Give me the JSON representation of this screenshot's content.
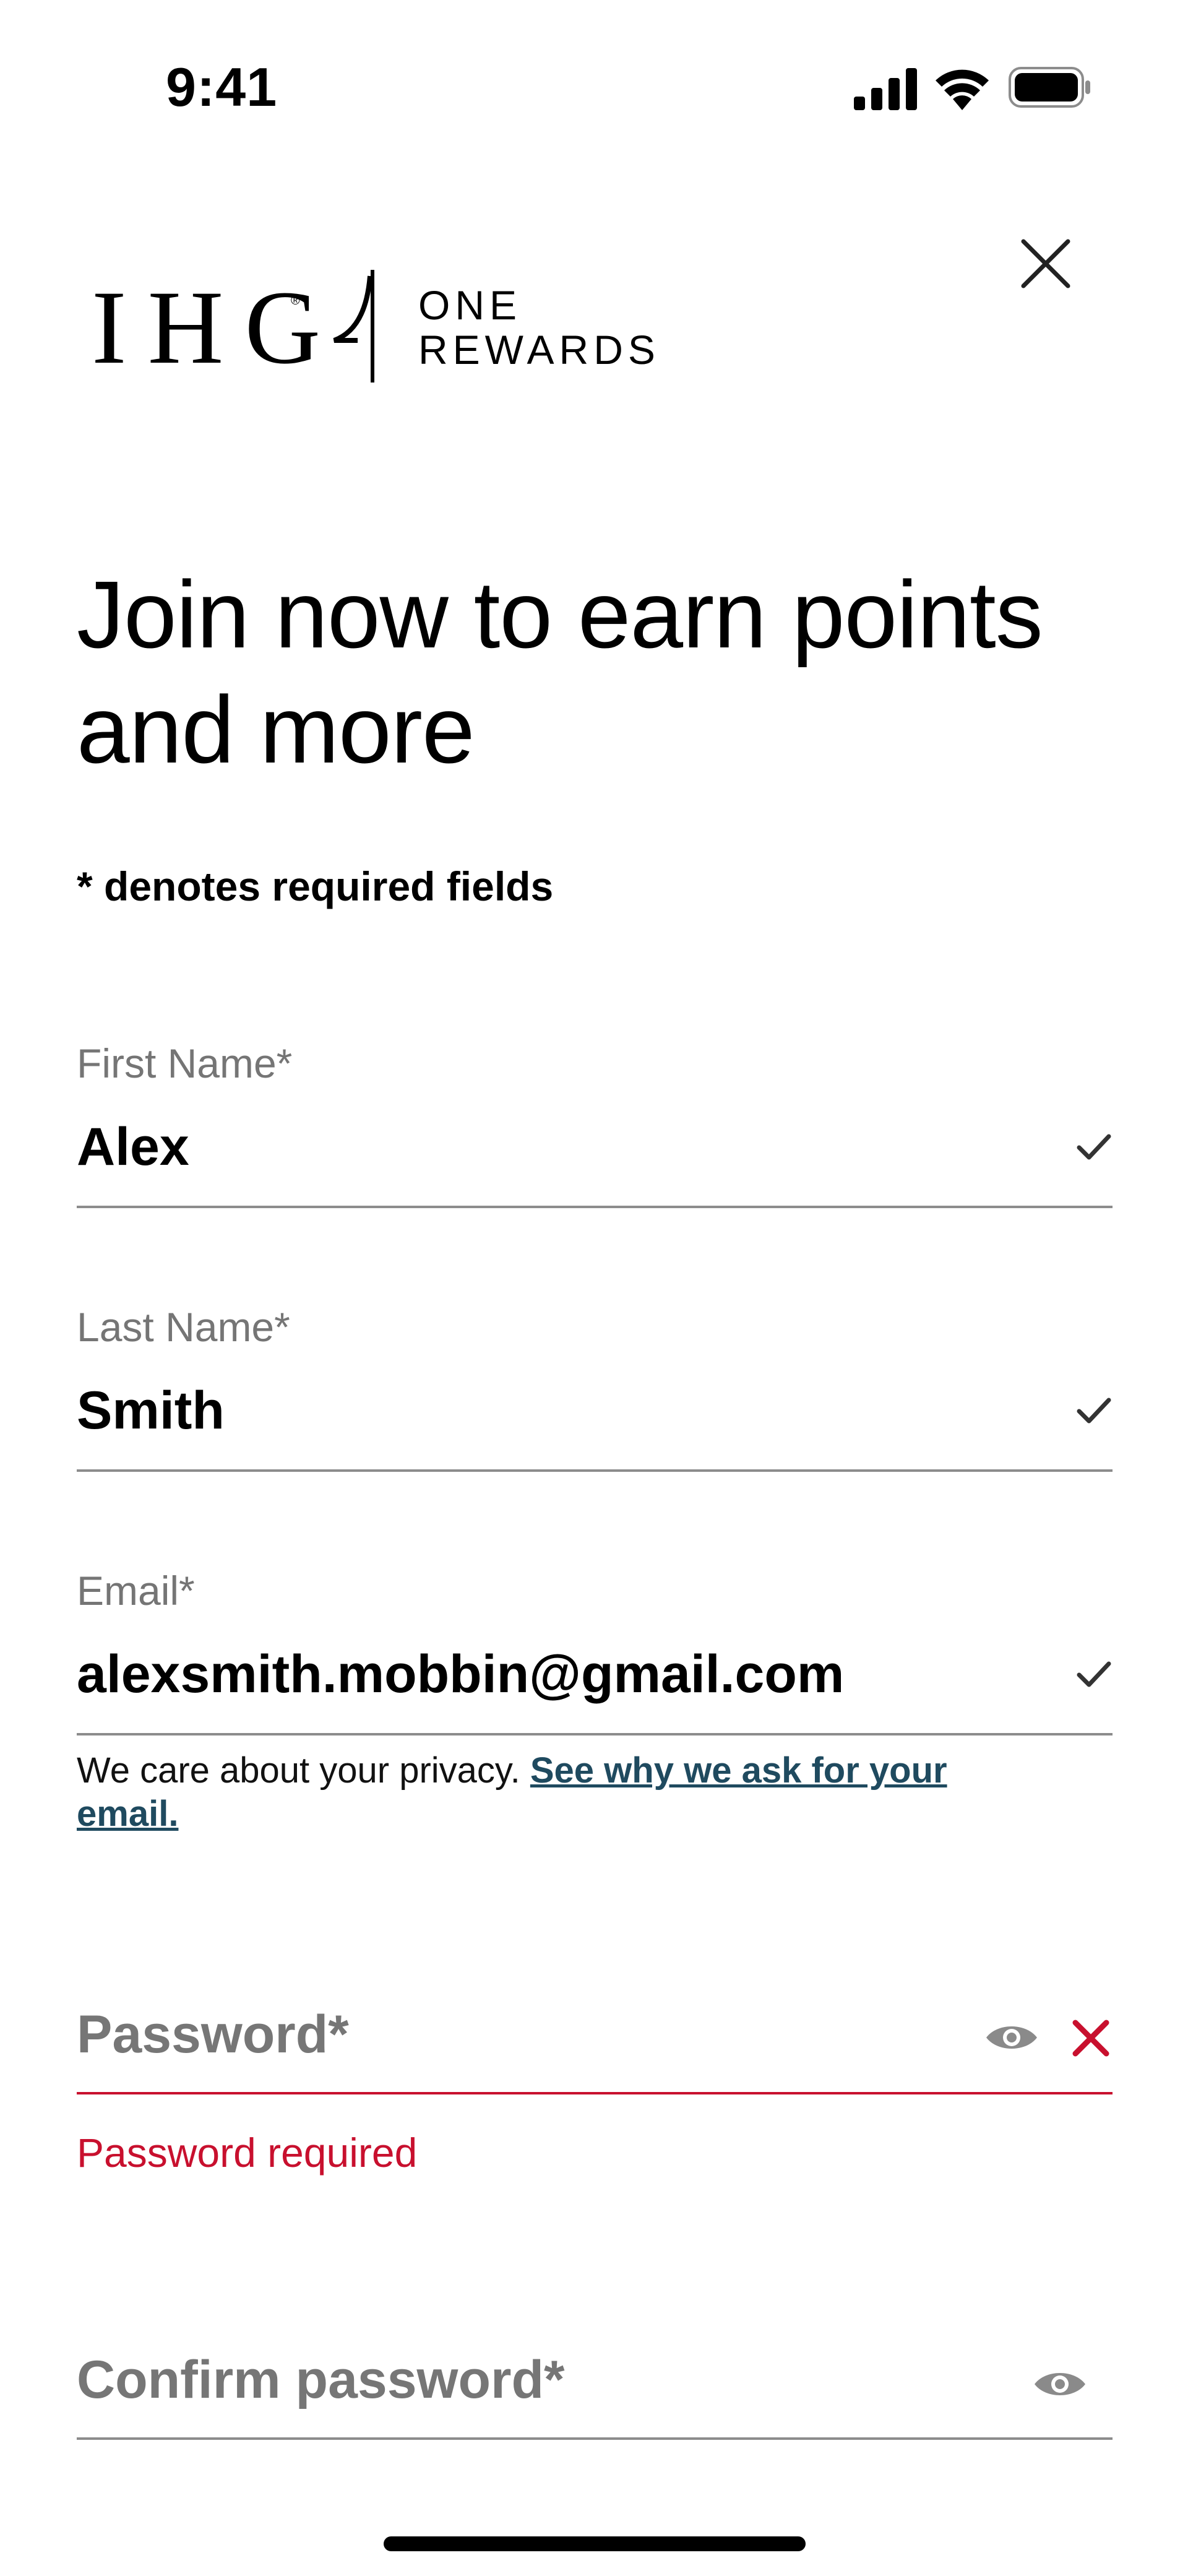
{
  "status_bar": {
    "time": "9:41",
    "icons": [
      "cellular-signal-icon",
      "wifi-icon",
      "battery-icon"
    ]
  },
  "header": {
    "logo": {
      "brand": "IHG",
      "program_line1": "ONE",
      "program_line2": "REWARDS"
    },
    "close_icon": "close-icon"
  },
  "title": "Join now to earn points and more",
  "required_note": "* denotes required fields",
  "form": {
    "first_name": {
      "label": "First Name*",
      "value": "Alex",
      "status": "valid"
    },
    "last_name": {
      "label": "Last Name*",
      "value": "Smith",
      "status": "valid"
    },
    "email": {
      "label": "Email*",
      "value": "alexsmith.mobbin@gmail.com",
      "status": "valid",
      "helper_text": "We care about your privacy.",
      "helper_link": "See why we ask for your email."
    },
    "password": {
      "placeholder": "Password*",
      "status": "error",
      "error_text": "Password required"
    },
    "confirm_password": {
      "placeholder": "Confirm password*"
    }
  },
  "colors": {
    "error": "#c8102e",
    "link": "#1f4a5f",
    "label_gray": "#757575",
    "underline": "#8c8c8c"
  }
}
